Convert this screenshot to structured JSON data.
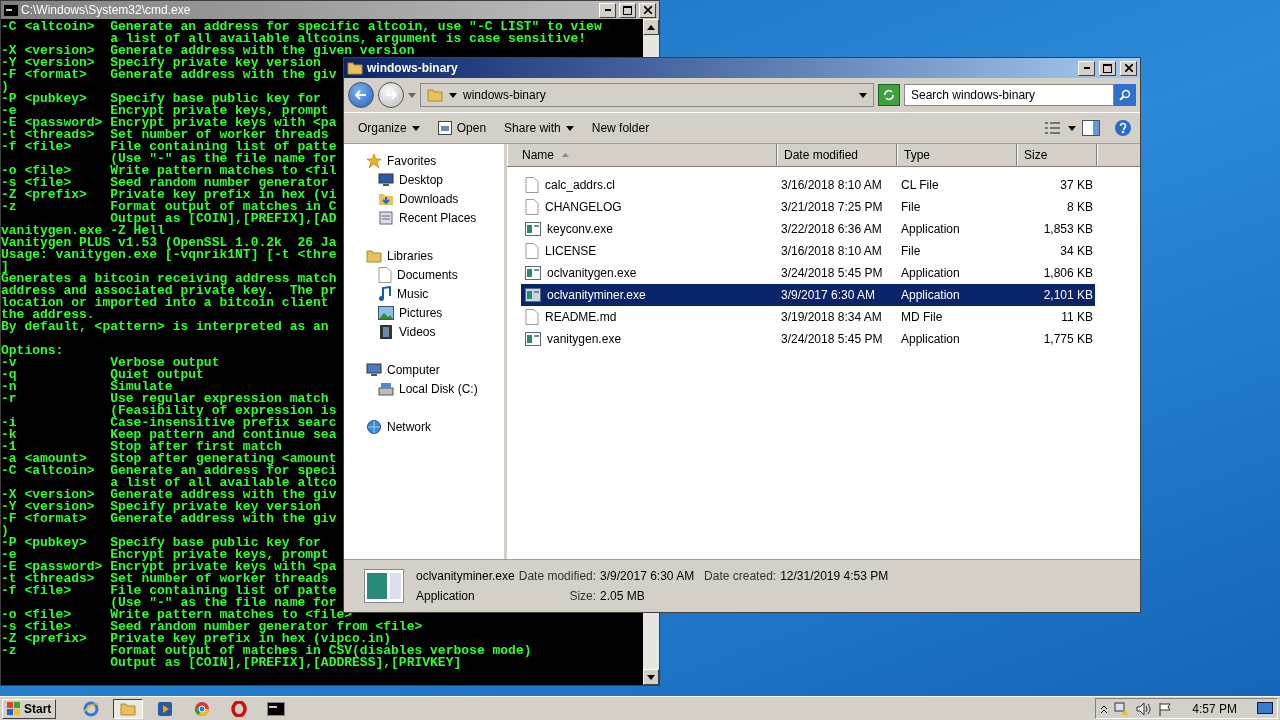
{
  "cmd_window": {
    "title": "C:\\Windows\\System32\\cmd.exe",
    "blocks": [
      {
        "lines": [
          "-C <altcoin>  Generate an address for specific altcoin, use \"-C LIST\" to view",
          "              a list of all available altcoins, argument is case sensitive!",
          "-X <version>  Generate address with the given version",
          "-Y <version>  Specify private key version",
          "-F <format>   Generate address with the giv",
          ")",
          "-P <pubkey>   Specify base public key for",
          "-e            Encrypt private keys, prompt",
          "-E <password> Encrypt private keys with <pa",
          "-t <threads>  Set number of worker threads",
          "-f <file>     File containing list of patte",
          "              (Use \"-\" as the file name for",
          "-o <file>     Write pattern matches to <fil",
          "-s <file>     Seed random number generator",
          "-Z <prefix>   Private key prefix in hex (vi",
          "-z            Format output of matches in C",
          "              Output as [COIN],[PREFIX],[AD",
          "vanitygen.exe -Z Hell",
          "Vanitygen PLUS v1.53 (OpenSSL 1.0.2k  26 Ja",
          "Usage: vanitygen.exe [-vqnrik1NT] [-t <thre",
          "]",
          "Generates a bitcoin receiving address match",
          "address and associated private key.  The pr",
          "location or imported into a bitcoin client",
          "the address.",
          "By default, <pattern> is interpreted as an"
        ]
      },
      {
        "lines": [
          "Options:",
          "-v            Verbose output",
          "-q            Quiet output",
          "-n            Simulate",
          "-r            Use regular expression match",
          "              (Feasibility of expression is",
          "-i            Case-insensitive prefix searc",
          "-k            Keep pattern and continue sea",
          "-1            Stop after first match",
          "-a <amount>   Stop after generating <amount",
          "-C <altcoin>  Generate an address for speci",
          "              a list of all available altco",
          "-X <version>  Generate address with the giv",
          "-Y <version>  Specify private key version",
          "-F <format>   Generate address with the giv",
          ")",
          "-P <pubkey>   Specify base public key for",
          "-e            Encrypt private keys, prompt",
          "-E <password> Encrypt private keys with <pa",
          "-t <threads>  Set number of worker threads",
          "-f <file>     File containing list of patte",
          "              (Use \"-\" as the file name for",
          "-o <file>     Write pattern matches to <file>",
          "-s <file>     Seed random number generator from <file>",
          "-Z <prefix>   Private key prefix in hex (vipco.in)",
          "-z            Format output of matches in CSV(disables verbose mode)",
          "              Output as [COIN],[PREFIX],[ADDRESS],[PRIVKEY]"
        ]
      }
    ]
  },
  "explorer": {
    "title": "windows-binary",
    "address": {
      "path": "windows-binary"
    },
    "search": {
      "placeholder": "Search windows-binary"
    },
    "toolbar": [
      {
        "label": "Organize",
        "kind": "menu"
      },
      {
        "label": "Open",
        "kind": "open"
      },
      {
        "label": "Share with",
        "kind": "menu"
      },
      {
        "label": "New folder",
        "kind": "plain"
      }
    ],
    "nav": [
      {
        "label": "Favorites",
        "children": [
          {
            "label": "Desktop"
          },
          {
            "label": "Downloads"
          },
          {
            "label": "Recent Places"
          }
        ]
      },
      {
        "label": "Libraries",
        "children": [
          {
            "label": "Documents"
          },
          {
            "label": "Music"
          },
          {
            "label": "Pictures"
          },
          {
            "label": "Videos"
          }
        ]
      },
      {
        "label": "Computer",
        "children": [
          {
            "label": "Local Disk (C:)"
          }
        ]
      },
      {
        "label": "Network"
      }
    ],
    "columns": [
      {
        "label": "Name",
        "sorted": true
      },
      {
        "label": "Date modified",
        "sorted": false
      },
      {
        "label": "Type",
        "sorted": false
      },
      {
        "label": "Size",
        "sorted": false
      }
    ],
    "files": [
      {
        "name": "calc_addrs.cl",
        "date": "3/16/2018 8:10 AM",
        "type": "CL File",
        "size": "37 KB",
        "kind": "document",
        "selected": false
      },
      {
        "name": "CHANGELOG",
        "date": "3/21/2018 7:25 PM",
        "type": "File",
        "size": "8 KB",
        "kind": "document",
        "selected": false
      },
      {
        "name": "keyconv.exe",
        "date": "3/22/2018 6:36 AM",
        "type": "Application",
        "size": "1,853 KB",
        "kind": "application",
        "selected": false
      },
      {
        "name": "LICENSE",
        "date": "3/16/2018 8:10 AM",
        "type": "File",
        "size": "34 KB",
        "kind": "document",
        "selected": false
      },
      {
        "name": "oclvanitygen.exe",
        "date": "3/24/2018 5:45 PM",
        "type": "Application",
        "size": "1,806 KB",
        "kind": "application",
        "selected": false
      },
      {
        "name": "oclvanityminer.exe",
        "date": "3/9/2017 6:30 AM",
        "type": "Application",
        "size": "2,101 KB",
        "kind": "application",
        "selected": true
      },
      {
        "name": "README.md",
        "date": "3/19/2018 8:34 AM",
        "type": "MD File",
        "size": "11 KB",
        "kind": "document",
        "selected": false
      },
      {
        "name": "vanitygen.exe",
        "date": "3/24/2018 5:45 PM",
        "type": "Application",
        "size": "1,775 KB",
        "kind": "application",
        "selected": false
      }
    ],
    "details": {
      "name": "oclvanityminer.exe",
      "type": "Application",
      "modified_label": "Date modified:",
      "modified": "3/9/2017 6:30 AM",
      "created_label": "Date created:",
      "created": "12/31/2019 4:53 PM",
      "size_label": "Size:",
      "size": "2.05 MB"
    }
  },
  "taskbar": {
    "start": "Start",
    "apps": [
      {
        "selected": false
      },
      {
        "selected": true
      },
      {
        "selected": false
      },
      {
        "selected": false
      },
      {
        "selected": false
      },
      {
        "selected": false
      }
    ],
    "clock": "4:57 PM"
  }
}
